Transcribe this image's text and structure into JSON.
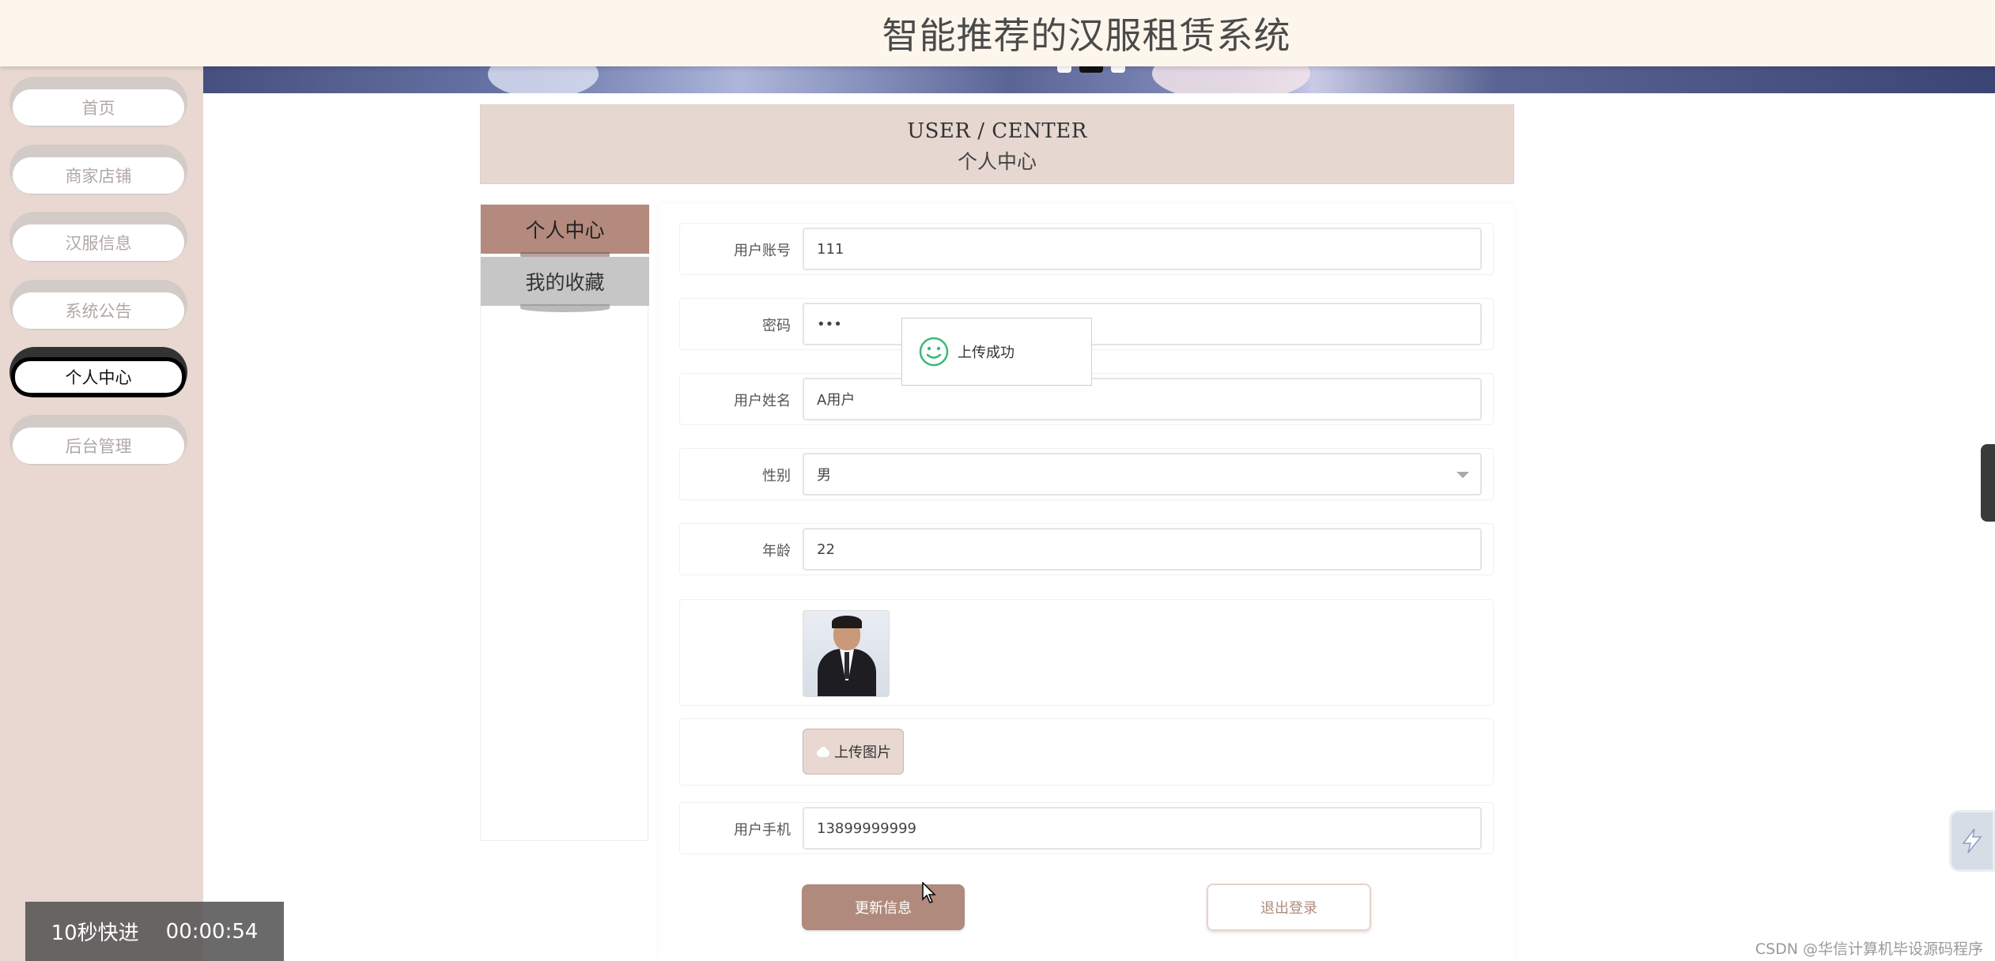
{
  "header": {
    "title": "智能推荐的汉服租赁系统"
  },
  "sidebar": {
    "items": [
      {
        "label": "首页",
        "active": false
      },
      {
        "label": "商家店铺",
        "active": false
      },
      {
        "label": "汉服信息",
        "active": false
      },
      {
        "label": "系统公告",
        "active": false
      },
      {
        "label": "个人中心",
        "active": true
      },
      {
        "label": "后台管理",
        "active": false
      }
    ]
  },
  "user_center": {
    "en_title": "USER / CENTER",
    "zh_title": "个人中心"
  },
  "left_menu": {
    "tabs": [
      {
        "label": "个人中心"
      },
      {
        "label": "我的收藏"
      }
    ]
  },
  "form": {
    "account": {
      "label": "用户账号",
      "value": "111"
    },
    "password": {
      "label": "密码",
      "value": "•••"
    },
    "name": {
      "label": "用户姓名",
      "value": "A用户"
    },
    "gender": {
      "label": "性别",
      "value": "男"
    },
    "age": {
      "label": "年龄",
      "value": "22"
    },
    "upload_label": "上传图片",
    "phone": {
      "label": "用户手机",
      "value": "13899999999"
    },
    "update_button": "更新信息",
    "logout_button": "退出登录"
  },
  "toast": {
    "message": "上传成功"
  },
  "video": {
    "skip_label": "10秒快进",
    "time": "00:00:54"
  },
  "watermark": "CSDN @华信计算机毕设源码程序",
  "colors": {
    "accent": "#b08a7c",
    "sidebar_bg": "#e8d8d1",
    "header_bg": "#fdf6ec"
  }
}
